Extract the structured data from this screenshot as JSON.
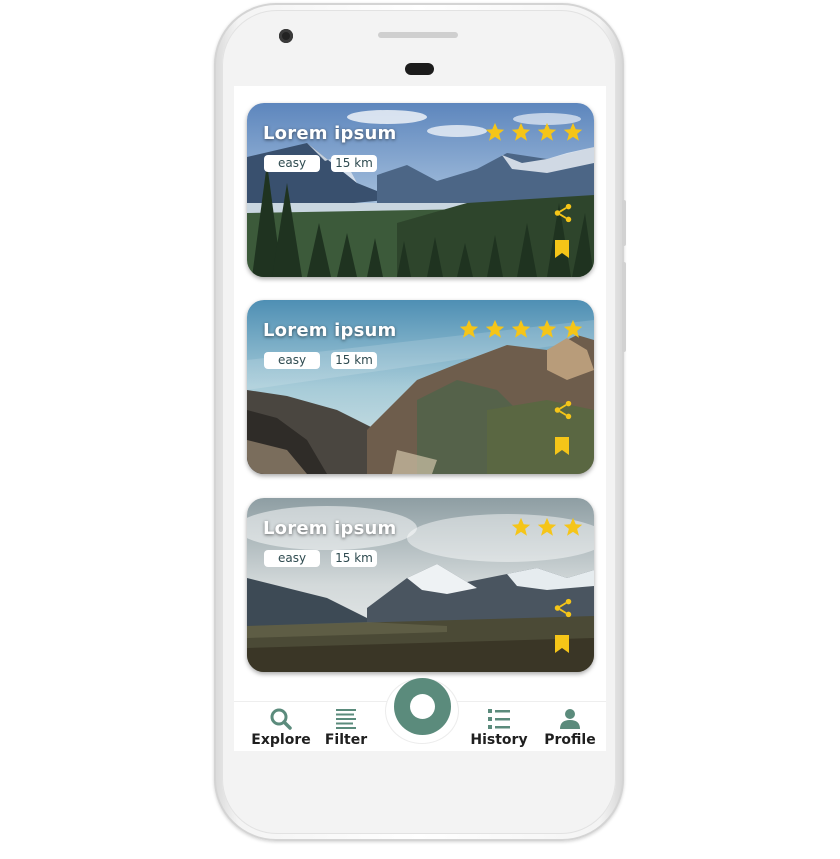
{
  "theme": {
    "accent": "#5b8b7c",
    "star_color": "#f5c518",
    "icon_color": "#f5c518",
    "nav_icon_color": "#5b8b7c"
  },
  "trails": [
    {
      "title": "Lorem ipsum",
      "difficulty": "easy",
      "distance": "15 km",
      "rating": 4,
      "scene": "alpine-valley-forest"
    },
    {
      "title": "Lorem ipsum",
      "difficulty": "easy",
      "distance": "15 km",
      "rating": 5,
      "scene": "misty-canyon"
    },
    {
      "title": "Lorem ipsum",
      "difficulty": "easy",
      "distance": "15 km",
      "rating": 3,
      "scene": "snowy-peaks-cloudy"
    }
  ],
  "nav": {
    "explore": {
      "label": "Explore",
      "icon": "search-icon"
    },
    "filter": {
      "label": "Filter",
      "icon": "filter-lines-icon"
    },
    "center": {
      "icon": "record-button-icon"
    },
    "history": {
      "label": "History",
      "icon": "list-icon"
    },
    "profile": {
      "label": "Profile",
      "icon": "person-icon"
    }
  }
}
